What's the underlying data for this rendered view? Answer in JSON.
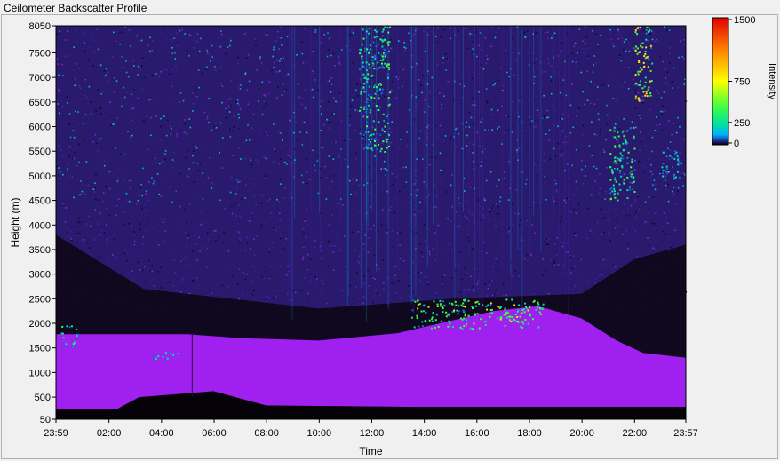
{
  "window": {
    "title": "Ceilometer Backscatter Profile"
  },
  "chart_data": {
    "type": "heatmap",
    "title": "",
    "xlabel": "Time",
    "ylabel": "Height (m)",
    "x_ticks": [
      "23:59",
      "02:00",
      "04:00",
      "06:00",
      "08:00",
      "10:00",
      "12:00",
      "14:00",
      "16:00",
      "18:00",
      "20:00",
      "22:00",
      "23:57"
    ],
    "y_ticks": [
      50,
      500,
      1000,
      1500,
      2000,
      2500,
      3000,
      3500,
      4000,
      4500,
      5000,
      5500,
      6000,
      6500,
      7000,
      7500,
      8050
    ],
    "ylim": [
      50,
      8050
    ],
    "xlim": [
      "23:59",
      "23:57"
    ],
    "colorbar": {
      "label": "Intensity",
      "ticks": [
        0,
        250,
        750,
        1500
      ],
      "colors": [
        "#000000",
        "#1e2a8c",
        "#5a1fb4",
        "#a020f0",
        "#00c8ff",
        "#00e0a0",
        "#40ff40",
        "#c0ff00",
        "#ffe000",
        "#ff8000",
        "#ff2000",
        "#e00000"
      ]
    },
    "layers": [
      {
        "name": "boundary-layer aerosol",
        "x_range": [
          "23:59",
          "23:57"
        ],
        "height_range": [
          300,
          2000
        ],
        "intensity": 60
      },
      {
        "name": "cloud near 1900 m",
        "x_range": [
          "00:10",
          "00:50"
        ],
        "height_range": [
          1500,
          2000
        ],
        "intensity": 350
      },
      {
        "name": "cloud near 1350 m",
        "x_range": [
          "03:30",
          "04:40"
        ],
        "height_range": [
          1250,
          1450
        ],
        "intensity": 300
      },
      {
        "name": "cloud tops near 2300 m",
        "x_range": [
          "13:30",
          "18:30"
        ],
        "height_range": [
          1900,
          2500
        ],
        "intensity": 500
      },
      {
        "name": "high cloud 7500-5500 m",
        "x_range": [
          "11:30",
          "12:40"
        ],
        "height_range": [
          5500,
          8050
        ],
        "intensity": 400
      },
      {
        "name": "high cloud near 5200 m",
        "x_range": [
          "21:00",
          "22:00"
        ],
        "height_range": [
          4500,
          6000
        ],
        "intensity": 400
      },
      {
        "name": "high cloud near 6800 m",
        "x_range": [
          "22:00",
          "22:40"
        ],
        "height_range": [
          6500,
          8050
        ],
        "intensity": 700
      },
      {
        "name": "high cloud near 5300 m",
        "x_range": [
          "23:00",
          "23:45"
        ],
        "height_range": [
          4900,
          5600
        ],
        "intensity": 300
      }
    ],
    "legend": "colorbar-right",
    "grid": false
  }
}
